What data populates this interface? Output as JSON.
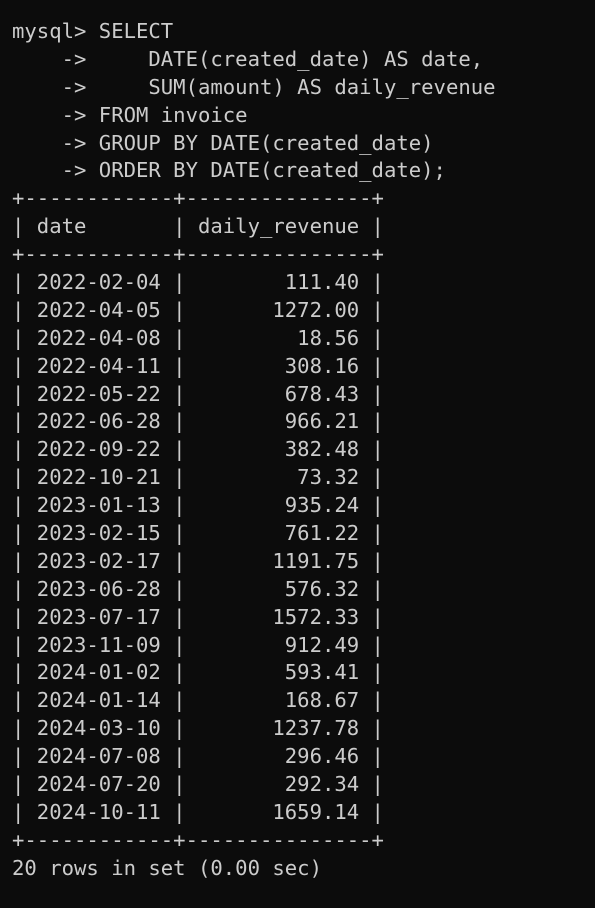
{
  "query_lines": [
    "mysql> SELECT",
    "    ->     DATE(created_date) AS date,",
    "    ->     SUM(amount) AS daily_revenue",
    "    -> FROM invoice",
    "    -> GROUP BY DATE(created_date)",
    "    -> ORDER BY DATE(created_date);"
  ],
  "table": {
    "border": "+------------+---------------+",
    "header": "| date       | daily_revenue |",
    "rows": [
      "| 2022-02-04 |        111.40 |",
      "| 2022-04-05 |       1272.00 |",
      "| 2022-04-08 |         18.56 |",
      "| 2022-04-11 |        308.16 |",
      "| 2022-05-22 |        678.43 |",
      "| 2022-06-28 |        966.21 |",
      "| 2022-09-22 |        382.48 |",
      "| 2022-10-21 |         73.32 |",
      "| 2023-01-13 |        935.24 |",
      "| 2023-02-15 |        761.22 |",
      "| 2023-02-17 |       1191.75 |",
      "| 2023-06-28 |        576.32 |",
      "| 2023-07-17 |       1572.33 |",
      "| 2023-11-09 |        912.49 |",
      "| 2024-01-02 |        593.41 |",
      "| 2024-01-14 |        168.67 |",
      "| 2024-03-10 |       1237.78 |",
      "| 2024-07-08 |        296.46 |",
      "| 2024-07-20 |        292.34 |",
      "| 2024-10-11 |       1659.14 |"
    ]
  },
  "status": "20 rows in set (0.00 sec)",
  "colors": {
    "background": "#0c0c0c",
    "text": "#cccccc"
  }
}
